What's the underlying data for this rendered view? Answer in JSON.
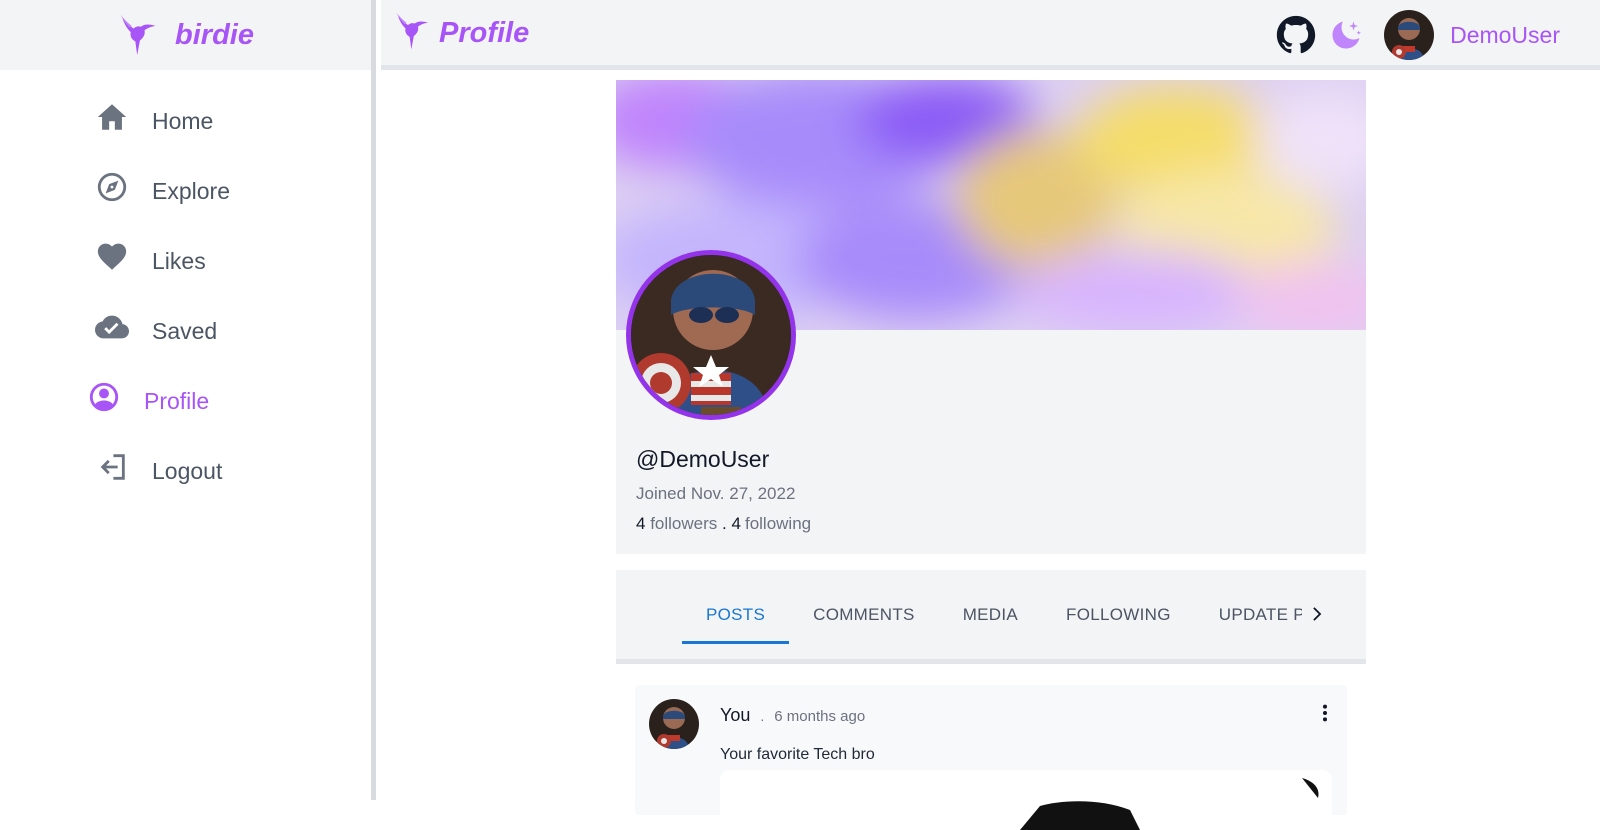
{
  "brand": {
    "name": "birdie"
  },
  "sidebar": {
    "items": [
      {
        "label": "Home",
        "icon": "home-icon"
      },
      {
        "label": "Explore",
        "icon": "compass-icon"
      },
      {
        "label": "Likes",
        "icon": "heart-icon"
      },
      {
        "label": "Saved",
        "icon": "cloud-check-icon"
      },
      {
        "label": "Profile",
        "icon": "user-circle-icon",
        "active": true
      },
      {
        "label": "Logout",
        "icon": "logout-icon"
      }
    ]
  },
  "header": {
    "title": "Profile",
    "username": "DemoUser",
    "github_icon": "github-icon",
    "theme_icon": "moon-icon"
  },
  "profile": {
    "handle": "@DemoUser",
    "joined": "Joined Nov. 27, 2022",
    "followers_count": "4",
    "followers_label": "followers",
    "separator": ".",
    "following_count": "4",
    "following_label": "following"
  },
  "tabs": [
    {
      "label": "POSTS",
      "active": true
    },
    {
      "label": "COMMENTS"
    },
    {
      "label": "MEDIA"
    },
    {
      "label": "FOLLOWING"
    },
    {
      "label": "UPDATE PROFILE"
    }
  ],
  "post": {
    "author": "You",
    "dot": ".",
    "time": "6 months ago",
    "text": "Your favorite Tech bro"
  },
  "colors": {
    "accent": "#a855f7",
    "tab_active": "#1976d2",
    "surface": "#f3f4f6"
  }
}
